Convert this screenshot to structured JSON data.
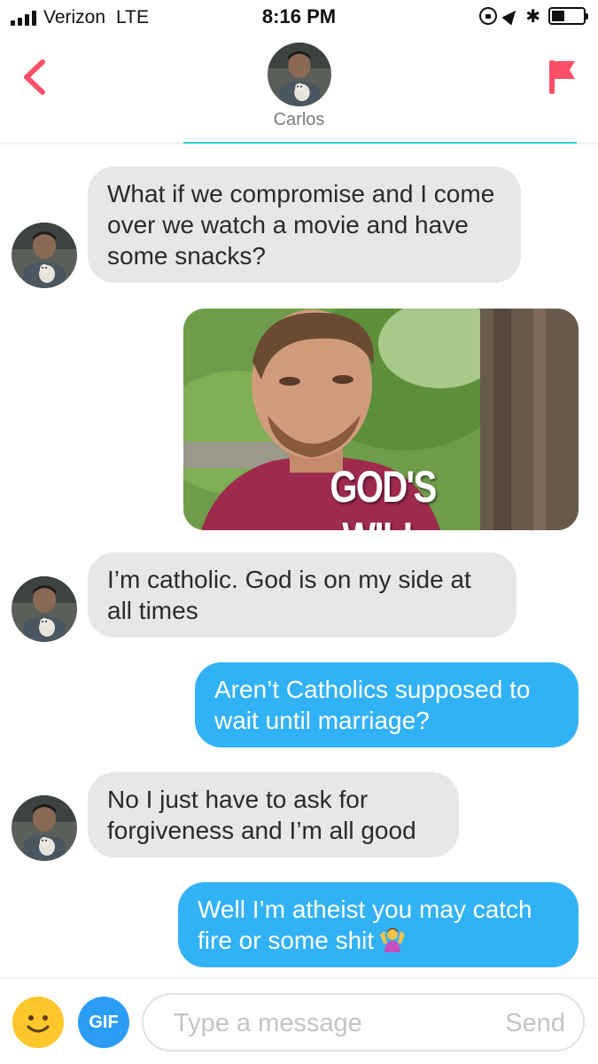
{
  "status_bar": {
    "carrier": "Verizon",
    "network": "LTE",
    "time": "8:16 PM",
    "battery_level": 0.4
  },
  "header": {
    "contact_name": "Carlos",
    "accent_color": "#fd5068"
  },
  "messages": [
    {
      "direction": "incoming",
      "type": "text",
      "text": "What if we compromise and I come over we watch a movie and have some snacks?"
    },
    {
      "direction": "outgoing",
      "type": "gif",
      "caption": "GOD'S WILL"
    },
    {
      "direction": "incoming",
      "type": "text",
      "text": "I’m catholic. God is on my side at all times"
    },
    {
      "direction": "outgoing",
      "type": "text",
      "text": "Aren’t Catholics supposed to wait until marriage?"
    },
    {
      "direction": "incoming",
      "type": "text",
      "text": "No I just have to ask for forgiveness and I’m all good"
    },
    {
      "direction": "outgoing",
      "type": "text",
      "text": "Well I’m atheist you may catch fire or some shit",
      "emoji": "person-shrugging"
    }
  ],
  "composer": {
    "emoji_button": "smiley-icon",
    "gif_label": "GIF",
    "placeholder": "Type a message",
    "send_label": "Send"
  },
  "colors": {
    "outgoing_bubble": "#32b2f6",
    "incoming_bubble": "#e7e7e9",
    "gif_button": "#2a9cf2",
    "emoji_button": "#ffc72c"
  }
}
